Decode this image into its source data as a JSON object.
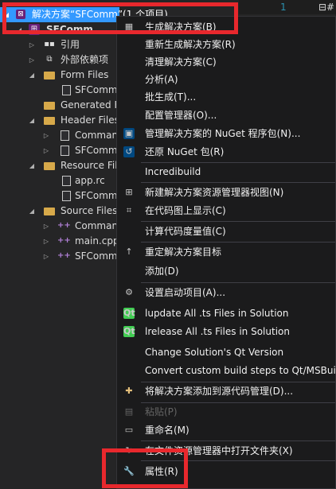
{
  "tree": {
    "solution_label": "解决方案“SFComm”(1 个项目)",
    "project": "SFComm",
    "items": [
      {
        "label": "引用"
      },
      {
        "label": "外部依赖项"
      },
      {
        "label": "Form Files"
      },
      {
        "label": "SFComm"
      },
      {
        "label": "Generated F"
      },
      {
        "label": "Header Files"
      },
      {
        "label": "Comman"
      },
      {
        "label": "SFComm"
      },
      {
        "label": "Resource Fil"
      },
      {
        "label": "app.rc"
      },
      {
        "label": "SFComm"
      },
      {
        "label": "Source Files"
      },
      {
        "label": "Comman"
      },
      {
        "label": "main.cpp"
      },
      {
        "label": "SFComm"
      }
    ]
  },
  "editor": {
    "line_number": "1",
    "code": "⊟#"
  },
  "menu": {
    "items": [
      {
        "label": "生成解决方案(B)",
        "icon": "build-icon"
      },
      {
        "label": "重新生成解决方案(R)"
      },
      {
        "label": "清理解决方案(C)"
      },
      {
        "label": "分析(A)"
      },
      {
        "label": "批生成(T)..."
      },
      {
        "label": "配置管理器(O)..."
      },
      {
        "label": "管理解决方案的 NuGet 程序包(N)...",
        "icon": "nuget-icon"
      },
      {
        "label": "还原 NuGet 包(R)",
        "icon": "restore-icon"
      },
      {
        "label": "Incredibuild"
      },
      {
        "label": "新建解决方案资源管理器视图(N)",
        "icon": "new-view-icon"
      },
      {
        "label": "在代码图上显示(C)",
        "icon": "code-map-icon"
      },
      {
        "label": "计算代码度量值(C)"
      },
      {
        "label": "重定解决方案目标",
        "icon": "retarget-icon"
      },
      {
        "label": "添加(D)"
      },
      {
        "label": "设置启动项目(A)...",
        "icon": "gear-icon"
      },
      {
        "label": "lupdate All .ts Files in Solution",
        "icon": "qt-icon"
      },
      {
        "label": "lrelease All .ts Files in Solution",
        "icon": "qt-icon"
      },
      {
        "label": "Change Solution's Qt Version"
      },
      {
        "label": "Convert custom build steps to Qt/MSBuild"
      },
      {
        "label": "将解决方案添加到源代码管理(D)...",
        "icon": "source-control-icon"
      },
      {
        "label": "粘贴(P)",
        "icon": "paste-icon",
        "disabled": true
      },
      {
        "label": "重命名(M)",
        "icon": "rename-icon"
      },
      {
        "label": "在文件资源管理器中打开文件夹(X)",
        "icon": "folder-open-icon"
      },
      {
        "label": "属性(R)",
        "icon": "wrench-icon"
      }
    ]
  },
  "colors": {
    "selection": "#3399ff",
    "highlight": "#e8282d",
    "menu_bg": "#1b1b1c"
  }
}
